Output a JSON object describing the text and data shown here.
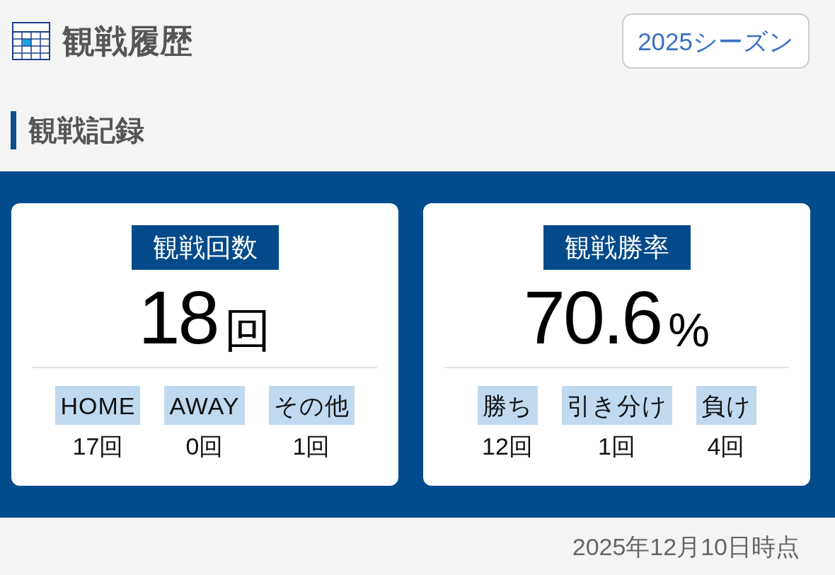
{
  "header": {
    "title": "観戦履歴",
    "season_button": "2025シーズン"
  },
  "section": {
    "title": "観戦記録"
  },
  "cards": [
    {
      "label": "観戦回数",
      "value": "18",
      "unit": "回",
      "breakdown": [
        {
          "label": "HOME",
          "value": "17回"
        },
        {
          "label": "AWAY",
          "value": "0回"
        },
        {
          "label": "その他",
          "value": "1回"
        }
      ]
    },
    {
      "label": "観戦勝率",
      "value": "70.6",
      "unit": "%",
      "breakdown": [
        {
          "label": "勝ち",
          "value": "12回"
        },
        {
          "label": "引き分け",
          "value": "1回"
        },
        {
          "label": "負け",
          "value": "4回"
        }
      ]
    }
  ],
  "as_of": "2025年12月10日時点"
}
